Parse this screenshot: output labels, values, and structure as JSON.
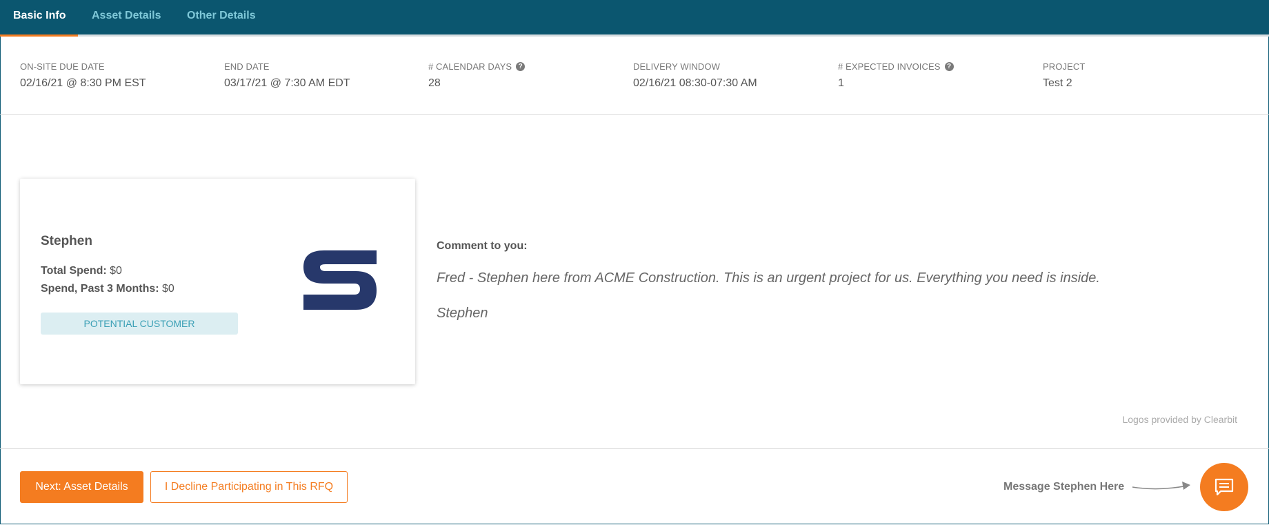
{
  "tabs": [
    {
      "label": "Basic Info",
      "active": true
    },
    {
      "label": "Asset Details",
      "active": false
    },
    {
      "label": "Other Details",
      "active": false
    }
  ],
  "stats": {
    "due_date": {
      "label": "On-Site Due Date",
      "value": "02/16/21 @ 8:30 PM EST"
    },
    "end_date": {
      "label": "End Date",
      "value": "03/17/21 @ 7:30 AM EDT"
    },
    "calendar_days": {
      "label": "# Calendar Days",
      "value": "28"
    },
    "delivery_window": {
      "label": "Delivery Window",
      "value": "02/16/21 08:30-07:30 AM"
    },
    "expected_invoices": {
      "label": "# Expected Invoices",
      "value": "1"
    },
    "project": {
      "label": "Project",
      "value": "Test 2"
    }
  },
  "help_glyph": "?",
  "customer": {
    "name": "Stephen",
    "total_spend_label": "Total Spend:",
    "total_spend_value": "$0",
    "spend_3m_label": "Spend, Past 3 Months:",
    "spend_3m_value": "$0",
    "status_badge": "Potential Customer",
    "logo_icon": "s-logo",
    "logo_color": "#27386b"
  },
  "comment": {
    "title": "Comment to you:",
    "body": "Fred - Stephen here from ACME Construction. This is an urgent project for us. Everything you need is inside.",
    "signature": "Stephen"
  },
  "attribution": "Logos provided by Clearbit",
  "footer": {
    "next_button": "Next: Asset Details",
    "decline_button": "I Decline Participating in This RFQ",
    "message_hint": "Message Stephen Here",
    "chat_icon": "chat-bubble-icon"
  },
  "colors": {
    "header_bg": "#0b566f",
    "accent": "#f47c20",
    "tab_inactive": "#7fc8d8",
    "badge_bg": "#dceef2",
    "badge_text": "#3a9fb5"
  }
}
